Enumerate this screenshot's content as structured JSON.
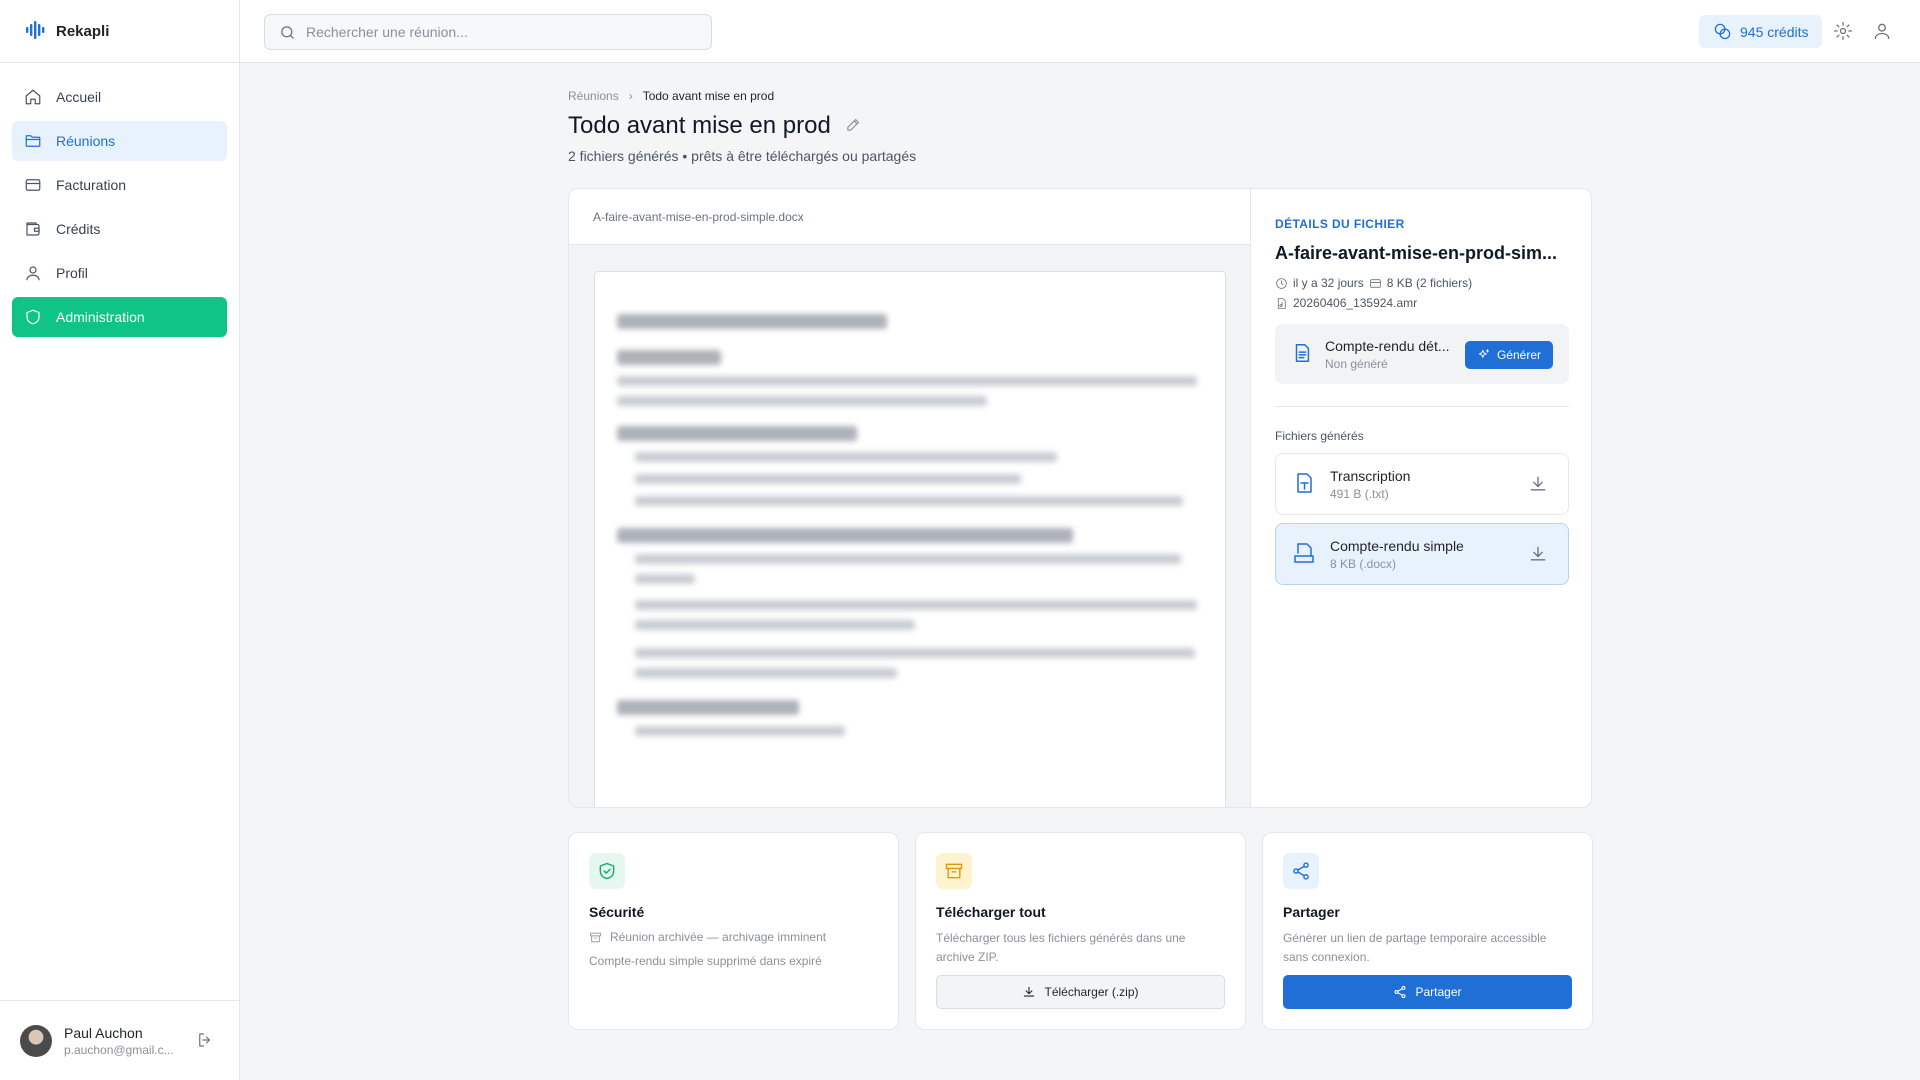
{
  "app": {
    "name": "Rekapli",
    "brand_color": "#1f6fd6",
    "admin_color": "#10c386"
  },
  "sidebar": {
    "items": [
      {
        "label": "Accueil",
        "icon": "home-icon"
      },
      {
        "label": "Réunions",
        "icon": "folder-icon",
        "active": true
      },
      {
        "label": "Facturation",
        "icon": "credit-card-icon"
      },
      {
        "label": "Crédits",
        "icon": "wallet-icon"
      },
      {
        "label": "Profil",
        "icon": "user-icon"
      },
      {
        "label": "Administration",
        "icon": "shield-icon"
      }
    ],
    "user": {
      "name": "Paul Auchon",
      "email": "p.auchon@gmail.c..."
    }
  },
  "topbar": {
    "search_placeholder": "Rechercher une réunion...",
    "credits": "945 crédits"
  },
  "breadcrumb": {
    "parent": "Réunions",
    "separator": "›",
    "current": "Todo avant mise en prod"
  },
  "page": {
    "title": "Todo avant mise en prod",
    "subtitle": "2 fichiers générés • prêts à être téléchargés ou partagés"
  },
  "preview": {
    "file_name": "A-faire-avant-mise-en-prod-simple.docx"
  },
  "details": {
    "label": "DÉTAILS DU FICHIER",
    "file_name": "A-faire-avant-mise-en-prod-sim...",
    "age": "il y a 32 jours",
    "size": "8 KB (2 fichiers)",
    "source": "20260406_135924.amr",
    "generate_card": {
      "title": "Compte-rendu dét...",
      "status": "Non généré",
      "button": "Générer"
    },
    "files_label": "Fichiers générés",
    "files": [
      {
        "name": "Transcription",
        "meta": "491 B (.txt)",
        "icon": "text-file-icon",
        "selected": false
      },
      {
        "name": "Compte-rendu simple",
        "meta": "8 KB (.docx)",
        "icon": "docx-file-icon",
        "selected": true
      }
    ]
  },
  "cards": {
    "security": {
      "title": "Sécurité",
      "line1": "Réunion archivée — archivage imminent",
      "line2": "Compte-rendu simple supprimé dans expiré"
    },
    "download": {
      "title": "Télécharger tout",
      "text": "Télécharger tous les fichiers générés dans une archive ZIP.",
      "button": "Télécharger (.zip)"
    },
    "share": {
      "title": "Partager",
      "text": "Générer un lien de partage temporaire accessible sans connexion.",
      "button": "Partager"
    }
  }
}
